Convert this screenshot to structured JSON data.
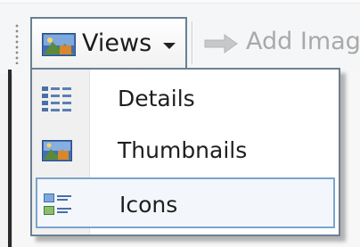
{
  "toolbar": {
    "views_label": "Views",
    "add_image_label": "Add Imag"
  },
  "menu": {
    "items": [
      {
        "label": "Details",
        "icon": "details-icon",
        "selected": false
      },
      {
        "label": "Thumbnails",
        "icon": "thumbnails-icon",
        "selected": false
      },
      {
        "label": "Icons",
        "icon": "icons-view-icon",
        "selected": true
      }
    ]
  },
  "colors": {
    "menu_border": "#6b7f93",
    "selection_border": "#7ba4cf",
    "disabled_text": "#a9a9a9"
  }
}
